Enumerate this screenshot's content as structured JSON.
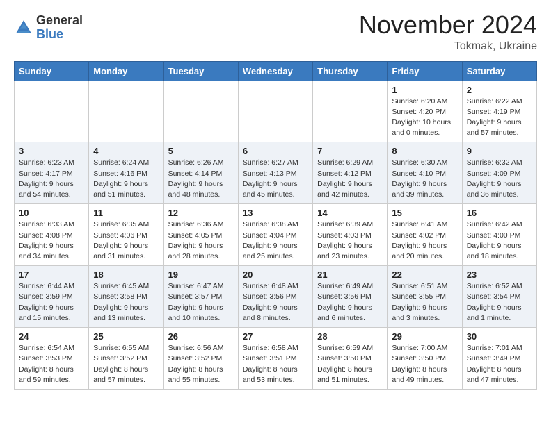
{
  "logo": {
    "general": "General",
    "blue": "Blue"
  },
  "header": {
    "month": "November 2024",
    "location": "Tokmak, Ukraine"
  },
  "days_of_week": [
    "Sunday",
    "Monday",
    "Tuesday",
    "Wednesday",
    "Thursday",
    "Friday",
    "Saturday"
  ],
  "weeks": [
    {
      "shaded": false,
      "days": [
        {
          "num": "",
          "info": ""
        },
        {
          "num": "",
          "info": ""
        },
        {
          "num": "",
          "info": ""
        },
        {
          "num": "",
          "info": ""
        },
        {
          "num": "",
          "info": ""
        },
        {
          "num": "1",
          "info": "Sunrise: 6:20 AM\nSunset: 4:20 PM\nDaylight: 10 hours\nand 0 minutes."
        },
        {
          "num": "2",
          "info": "Sunrise: 6:22 AM\nSunset: 4:19 PM\nDaylight: 9 hours\nand 57 minutes."
        }
      ]
    },
    {
      "shaded": true,
      "days": [
        {
          "num": "3",
          "info": "Sunrise: 6:23 AM\nSunset: 4:17 PM\nDaylight: 9 hours\nand 54 minutes."
        },
        {
          "num": "4",
          "info": "Sunrise: 6:24 AM\nSunset: 4:16 PM\nDaylight: 9 hours\nand 51 minutes."
        },
        {
          "num": "5",
          "info": "Sunrise: 6:26 AM\nSunset: 4:14 PM\nDaylight: 9 hours\nand 48 minutes."
        },
        {
          "num": "6",
          "info": "Sunrise: 6:27 AM\nSunset: 4:13 PM\nDaylight: 9 hours\nand 45 minutes."
        },
        {
          "num": "7",
          "info": "Sunrise: 6:29 AM\nSunset: 4:12 PM\nDaylight: 9 hours\nand 42 minutes."
        },
        {
          "num": "8",
          "info": "Sunrise: 6:30 AM\nSunset: 4:10 PM\nDaylight: 9 hours\nand 39 minutes."
        },
        {
          "num": "9",
          "info": "Sunrise: 6:32 AM\nSunset: 4:09 PM\nDaylight: 9 hours\nand 36 minutes."
        }
      ]
    },
    {
      "shaded": false,
      "days": [
        {
          "num": "10",
          "info": "Sunrise: 6:33 AM\nSunset: 4:08 PM\nDaylight: 9 hours\nand 34 minutes."
        },
        {
          "num": "11",
          "info": "Sunrise: 6:35 AM\nSunset: 4:06 PM\nDaylight: 9 hours\nand 31 minutes."
        },
        {
          "num": "12",
          "info": "Sunrise: 6:36 AM\nSunset: 4:05 PM\nDaylight: 9 hours\nand 28 minutes."
        },
        {
          "num": "13",
          "info": "Sunrise: 6:38 AM\nSunset: 4:04 PM\nDaylight: 9 hours\nand 25 minutes."
        },
        {
          "num": "14",
          "info": "Sunrise: 6:39 AM\nSunset: 4:03 PM\nDaylight: 9 hours\nand 23 minutes."
        },
        {
          "num": "15",
          "info": "Sunrise: 6:41 AM\nSunset: 4:02 PM\nDaylight: 9 hours\nand 20 minutes."
        },
        {
          "num": "16",
          "info": "Sunrise: 6:42 AM\nSunset: 4:00 PM\nDaylight: 9 hours\nand 18 minutes."
        }
      ]
    },
    {
      "shaded": true,
      "days": [
        {
          "num": "17",
          "info": "Sunrise: 6:44 AM\nSunset: 3:59 PM\nDaylight: 9 hours\nand 15 minutes."
        },
        {
          "num": "18",
          "info": "Sunrise: 6:45 AM\nSunset: 3:58 PM\nDaylight: 9 hours\nand 13 minutes."
        },
        {
          "num": "19",
          "info": "Sunrise: 6:47 AM\nSunset: 3:57 PM\nDaylight: 9 hours\nand 10 minutes."
        },
        {
          "num": "20",
          "info": "Sunrise: 6:48 AM\nSunset: 3:56 PM\nDaylight: 9 hours\nand 8 minutes."
        },
        {
          "num": "21",
          "info": "Sunrise: 6:49 AM\nSunset: 3:56 PM\nDaylight: 9 hours\nand 6 minutes."
        },
        {
          "num": "22",
          "info": "Sunrise: 6:51 AM\nSunset: 3:55 PM\nDaylight: 9 hours\nand 3 minutes."
        },
        {
          "num": "23",
          "info": "Sunrise: 6:52 AM\nSunset: 3:54 PM\nDaylight: 9 hours\nand 1 minute."
        }
      ]
    },
    {
      "shaded": false,
      "days": [
        {
          "num": "24",
          "info": "Sunrise: 6:54 AM\nSunset: 3:53 PM\nDaylight: 8 hours\nand 59 minutes."
        },
        {
          "num": "25",
          "info": "Sunrise: 6:55 AM\nSunset: 3:52 PM\nDaylight: 8 hours\nand 57 minutes."
        },
        {
          "num": "26",
          "info": "Sunrise: 6:56 AM\nSunset: 3:52 PM\nDaylight: 8 hours\nand 55 minutes."
        },
        {
          "num": "27",
          "info": "Sunrise: 6:58 AM\nSunset: 3:51 PM\nDaylight: 8 hours\nand 53 minutes."
        },
        {
          "num": "28",
          "info": "Sunrise: 6:59 AM\nSunset: 3:50 PM\nDaylight: 8 hours\nand 51 minutes."
        },
        {
          "num": "29",
          "info": "Sunrise: 7:00 AM\nSunset: 3:50 PM\nDaylight: 8 hours\nand 49 minutes."
        },
        {
          "num": "30",
          "info": "Sunrise: 7:01 AM\nSunset: 3:49 PM\nDaylight: 8 hours\nand 47 minutes."
        }
      ]
    }
  ]
}
